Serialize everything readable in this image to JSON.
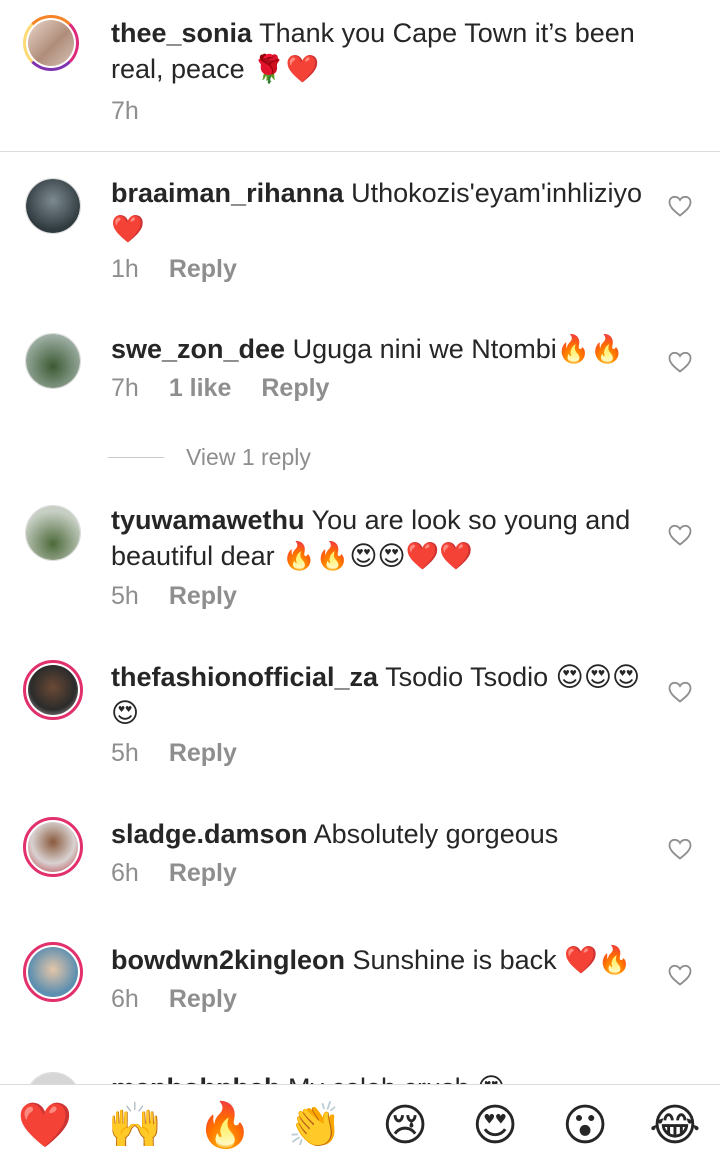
{
  "caption": {
    "username": "thee_sonia",
    "text": "Thank you Cape Town it’s been real, peace 🌹❤️",
    "time": "7h"
  },
  "comments": [
    {
      "username": "braaiman_rihanna",
      "text": "Uthokozis'eyam'inhliziyo ❤️",
      "time": "1h",
      "reply": "Reply"
    },
    {
      "username": "swe_zon_dee",
      "text": "Uguga nini we Ntombi🔥🔥",
      "time": "7h",
      "likes": "1 like",
      "reply": "Reply"
    },
    {
      "username": "tyuwamawethu",
      "text": "You are look so young and beautiful dear 🔥🔥😍😍❤️❤️",
      "time": "5h",
      "reply": "Reply"
    },
    {
      "username": "thefashionofficial_za",
      "text": "Tsodio Tsodio 😍😍😍😍",
      "time": "5h",
      "reply": "Reply"
    },
    {
      "username": "sladge.damson",
      "text": "Absolutely gorgeous",
      "time": "6h",
      "reply": "Reply"
    },
    {
      "username": "bowdwn2kingleon",
      "text": "Sunshine is back ❤️🔥",
      "time": "6h",
      "reply": "Reply"
    }
  ],
  "view_replies": "View 1 reply",
  "partial_comment": {
    "username": "maphohphah",
    "text": "My celeb crush 😍"
  },
  "reactions": [
    "❤️",
    "🙌",
    "🔥",
    "👏",
    "😢",
    "😍",
    "😮",
    "😂"
  ],
  "colors": {
    "text": "#262626",
    "meta": "#8e8e8e",
    "ring": "#e1306c",
    "divider": "#dbdbdb"
  },
  "icons": {
    "like": "heart-outline-icon"
  }
}
